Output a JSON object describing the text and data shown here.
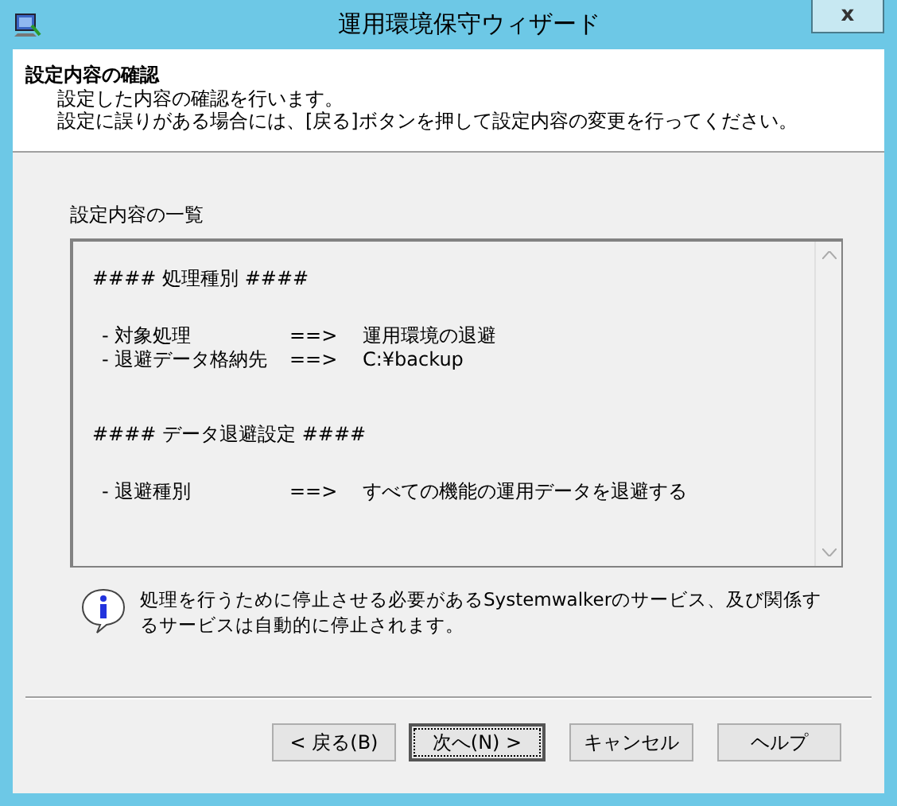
{
  "window": {
    "title": "運用環境保守ウィザード",
    "close": "x"
  },
  "header": {
    "title": "設定内容の確認",
    "lines": [
      "設定した内容の確認を行います。",
      "設定に誤りがある場合には、[戻る]ボタンを押して設定内容の変更を行ってください。"
    ]
  },
  "summary": {
    "label": "設定内容の一覧",
    "lines": [
      {
        "kind": "heading",
        "text": "#### 処理種別 ####"
      },
      {
        "kind": "item",
        "label": "- 対象処理",
        "arrow": "==>",
        "value": "運用環境の退避"
      },
      {
        "kind": "item",
        "label": "- 退避データ格納先",
        "arrow": "==>",
        "value": "C:¥backup"
      },
      {
        "kind": "heading",
        "text": "#### データ退避設定 ####"
      },
      {
        "kind": "item",
        "label": "- 退避種別",
        "arrow": "==>",
        "value": "すべての機能の運用データを退避する"
      }
    ]
  },
  "note": "処理を行うために停止させる必要があるSystemwalkerのサービス、及び関係するサービスは自動的に停止されます。",
  "buttons": [
    {
      "label": "< 戻る(B)",
      "default": false
    },
    {
      "label": "次へ(N) >",
      "default": true
    },
    {
      "label": "キャンセル",
      "default": false
    },
    {
      "label": "ヘルプ",
      "default": false
    }
  ]
}
